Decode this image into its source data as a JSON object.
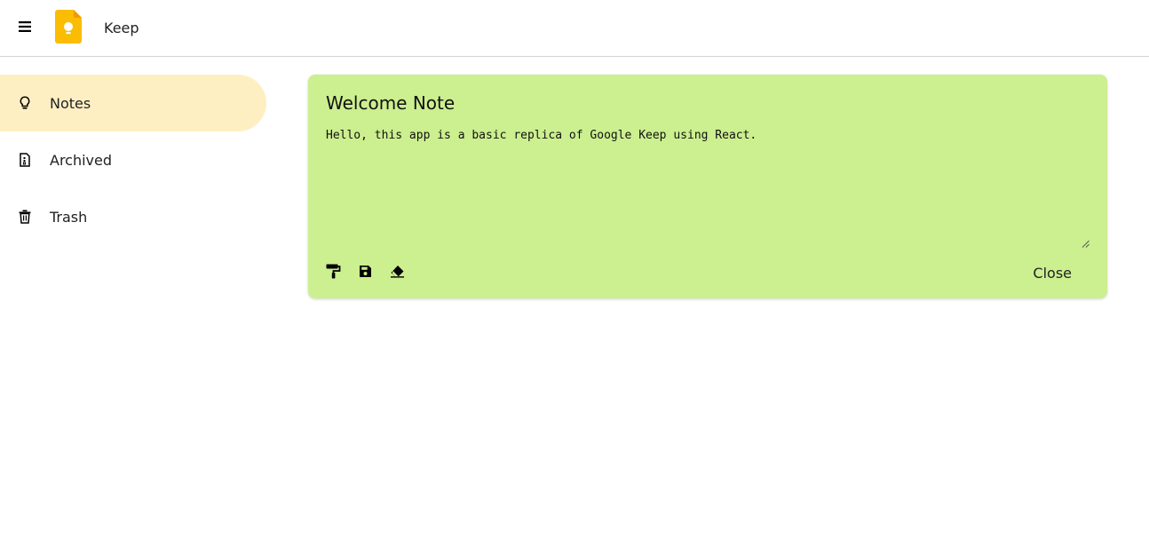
{
  "header": {
    "menu_icon": "hamburger-menu-icon",
    "logo_icon": "keep-logo-icon",
    "title": "Keep"
  },
  "sidebar": {
    "items": [
      {
        "label": "Notes",
        "icon": "lightbulb-icon",
        "active": true
      },
      {
        "label": "Archived",
        "icon": "archive-icon",
        "active": false
      },
      {
        "label": "Trash",
        "icon": "trash-icon",
        "active": false
      }
    ]
  },
  "note": {
    "title": "Welcome Note",
    "body": "Hello, this app is a basic replica of Google Keep using React.",
    "background_color": "#ccef8f",
    "toolbar": {
      "icons": [
        "paint-roller-icon",
        "save-icon",
        "eraser-icon"
      ]
    },
    "close_label": "Close"
  },
  "colors": {
    "active_nav_bg": "#feefc3",
    "logo_yellow": "#fbbc04",
    "note_bg": "#ccef8f"
  }
}
